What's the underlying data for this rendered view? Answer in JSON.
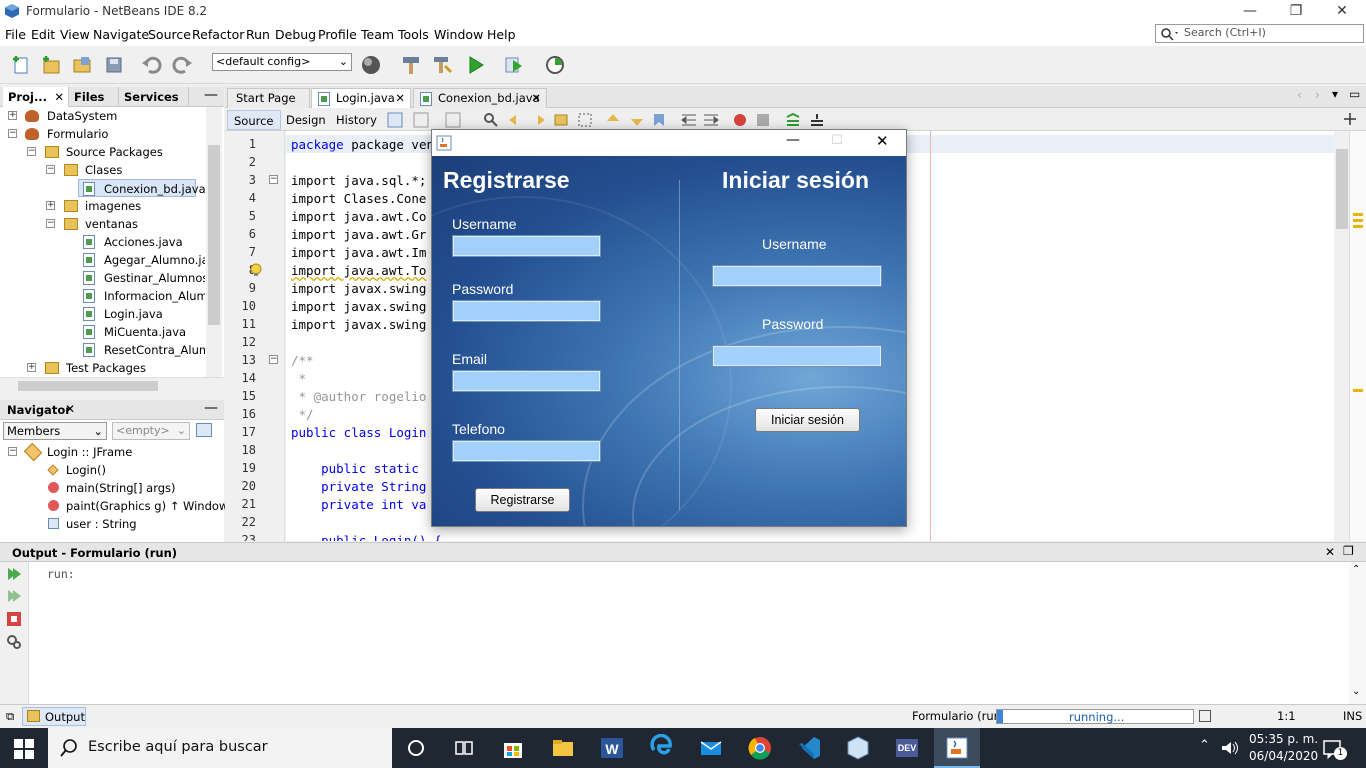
{
  "window": {
    "title": "Formulario - NetBeans IDE 8.2"
  },
  "menu": [
    "File",
    "Edit",
    "View",
    "Navigate",
    "Source",
    "Refactor",
    "Run",
    "Debug",
    "Profile",
    "Team",
    "Tools",
    "Window",
    "Help"
  ],
  "search": {
    "placeholder": "Search (Ctrl+I)"
  },
  "toolbar": {
    "config": "<default config>"
  },
  "projects_panel": {
    "tabs": [
      "Proj...",
      "Files",
      "Services"
    ],
    "tree": [
      {
        "label": "DataSystem",
        "type": "project",
        "level": 0
      },
      {
        "label": "Formulario",
        "type": "project",
        "level": 0
      },
      {
        "label": "Source Packages",
        "type": "package",
        "level": 1
      },
      {
        "label": "Clases",
        "type": "package",
        "level": 2
      },
      {
        "label": "Conexion_bd.java",
        "type": "java",
        "level": 3,
        "selected": true
      },
      {
        "label": "imagenes",
        "type": "package",
        "level": 2
      },
      {
        "label": "ventanas",
        "type": "package",
        "level": 2
      },
      {
        "label": "Acciones.java",
        "type": "java",
        "level": 3
      },
      {
        "label": "Agegar_Alumno.java",
        "type": "java",
        "level": 3
      },
      {
        "label": "Gestinar_Alumnos.ja",
        "type": "java",
        "level": 3
      },
      {
        "label": "Informacion_Alumnos",
        "type": "java",
        "level": 3
      },
      {
        "label": "Login.java",
        "type": "java",
        "level": 3
      },
      {
        "label": "MiCuenta.java",
        "type": "java",
        "level": 3
      },
      {
        "label": "ResetContra_Alumnc",
        "type": "java",
        "level": 3
      },
      {
        "label": "Test Packages",
        "type": "package",
        "level": 1
      }
    ]
  },
  "navigator": {
    "title": "Navigator",
    "filter": "Members",
    "empty": "<empty>",
    "root": "Login :: JFrame",
    "items": [
      {
        "name": "Login()",
        "extra": ""
      },
      {
        "name": "main(String[] args)",
        "extra": ""
      },
      {
        "name": "paint(Graphics g) ↑ Window",
        "extra": ""
      },
      {
        "name": "user : String",
        "extra": ""
      }
    ]
  },
  "editor": {
    "tabs": [
      "Start Page",
      "Login.java",
      "Conexion_bd.java"
    ],
    "subtabs": [
      "Source",
      "Design",
      "History"
    ],
    "line_numbers": [
      "1",
      "2",
      "3",
      "4",
      "5",
      "6",
      "7",
      "8",
      "9",
      "10",
      "11",
      "12",
      "13",
      "14",
      "15",
      "16",
      "17",
      "18",
      "19",
      "20",
      "21",
      "22",
      "23"
    ],
    "lines": [
      "package ventanas;",
      "",
      "import java.sql.*;",
      "import Clases.Cone",
      "import java.awt.Co",
      "import java.awt.Gr",
      "import java.awt.Im",
      "import java.awt.To",
      "import javax.swing",
      "import javax.swing",
      "import javax.swing",
      "",
      "/**",
      " *",
      " * @author rogelio",
      " */",
      "public class Login",
      "",
      "    public static",
      "    private String",
      "    private int va",
      "",
      "    public Login() {"
    ]
  },
  "dialog": {
    "register_title": "Registrarse",
    "login_title": "Iniciar sesión",
    "username_label": "Username",
    "password_label": "Password",
    "email_label": "Email",
    "telefono_label": "Telefono",
    "register_button": "Registrarse",
    "login_username_label": "Username",
    "login_password_label": "Password",
    "login_button": "Iniciar sesión"
  },
  "output": {
    "title": "Output - Formulario (run)",
    "text": "run:",
    "tab": "Output"
  },
  "status": {
    "project": "Formulario (run)",
    "progress": "running...",
    "position": "1:1",
    "mode": "INS"
  },
  "taskbar": {
    "search_placeholder": "Escribe aquí para buscar",
    "time": "05:35 p. m.",
    "date": "06/04/2020",
    "notifications": "1"
  }
}
